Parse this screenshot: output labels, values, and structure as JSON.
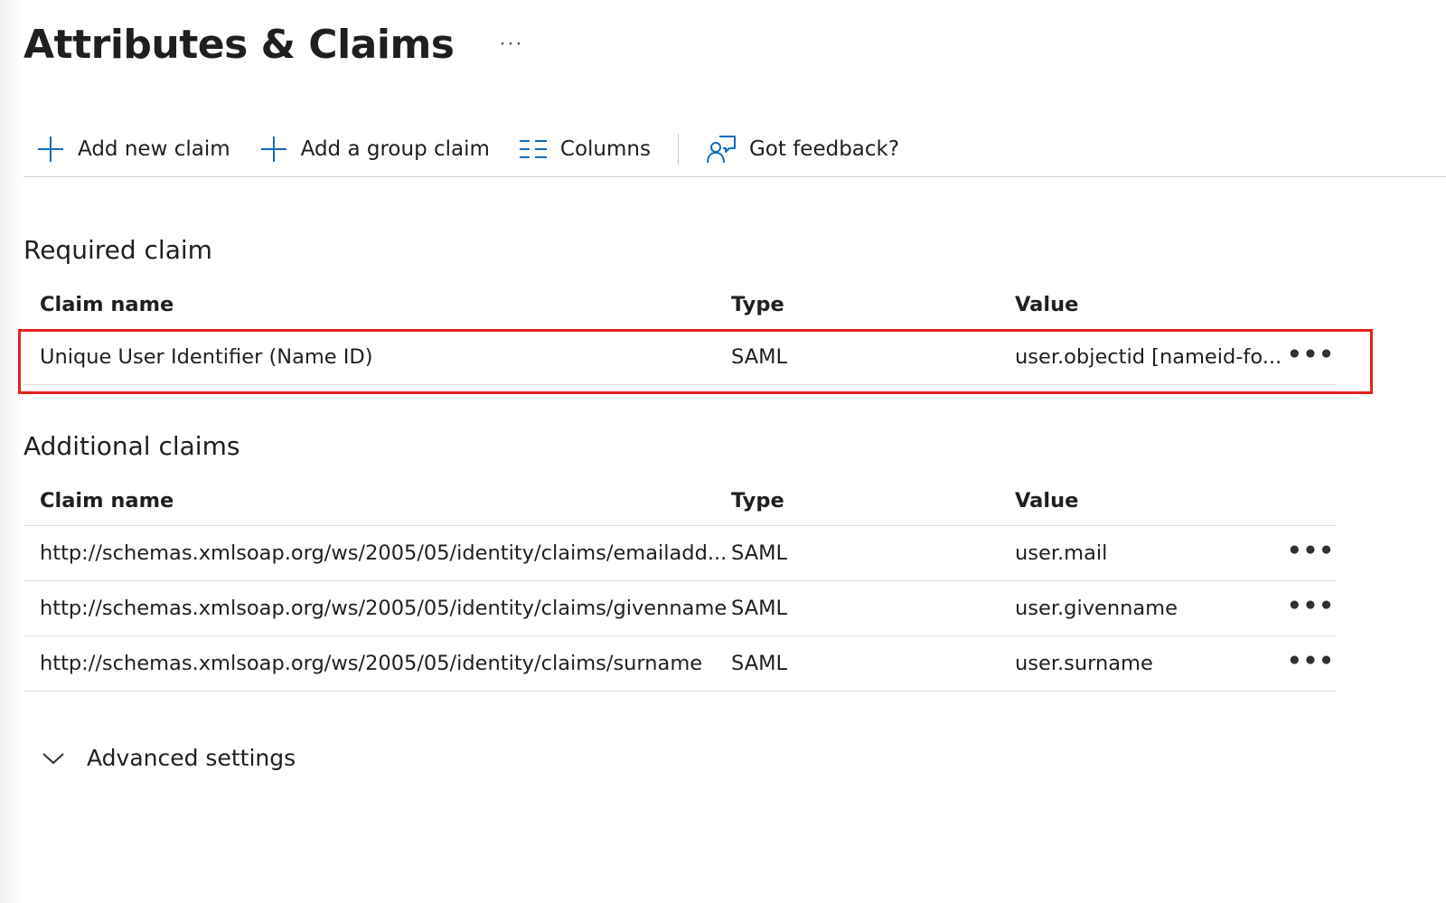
{
  "header": {
    "title": "Attributes & Claims",
    "more_label": "···"
  },
  "toolbar": {
    "add_new_claim": "Add new claim",
    "add_group_claim": "Add a group claim",
    "columns": "Columns",
    "feedback": "Got feedback?"
  },
  "required": {
    "title": "Required claim",
    "columns": {
      "name": "Claim name",
      "type": "Type",
      "value": "Value"
    },
    "rows": [
      {
        "name": "Unique User Identifier (Name ID)",
        "type": "SAML",
        "value": "user.objectid [nameid-fo..."
      }
    ]
  },
  "additional": {
    "title": "Additional claims",
    "columns": {
      "name": "Claim name",
      "type": "Type",
      "value": "Value"
    },
    "rows": [
      {
        "name": "http://schemas.xmlsoap.org/ws/2005/05/identity/claims/emailadd...",
        "type": "SAML",
        "value": "user.mail"
      },
      {
        "name": "http://schemas.xmlsoap.org/ws/2005/05/identity/claims/givenname",
        "type": "SAML",
        "value": "user.givenname"
      },
      {
        "name": "http://schemas.xmlsoap.org/ws/2005/05/identity/claims/surname",
        "type": "SAML",
        "value": "user.surname"
      }
    ]
  },
  "row_more_label": "•••",
  "advanced": {
    "label": "Advanced settings"
  },
  "colors": {
    "accent": "#0f6cbd",
    "highlight": "#e8211c"
  },
  "icons": [
    "plus-icon",
    "columns-icon",
    "feedback-icon",
    "chevron-down-icon",
    "more-icon"
  ]
}
